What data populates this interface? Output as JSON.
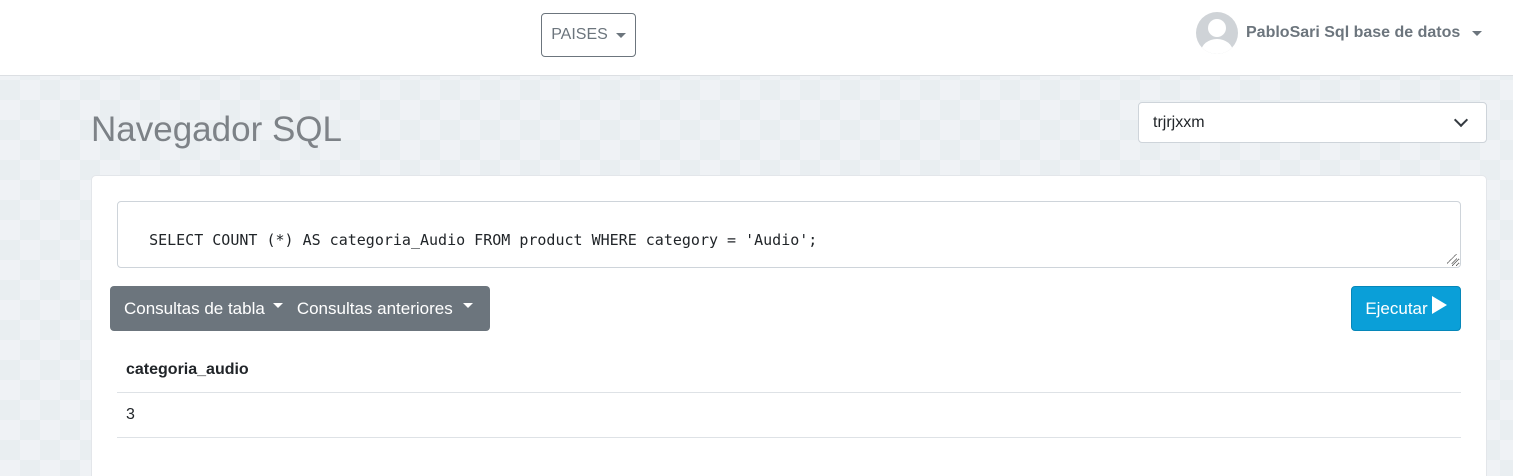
{
  "navbar": {
    "paises_label": "PAISES",
    "user_label": "PabloSari Sql base de datos"
  },
  "page": {
    "title": "Navegador SQL"
  },
  "database_select": {
    "selected": "trjrjxxm"
  },
  "query": {
    "text": "SELECT COUNT (*) AS categoria_Audio FROM product WHERE category = 'Audio';"
  },
  "toolbar": {
    "table_queries_label": "Consultas de tabla",
    "previous_queries_label": "Consultas anteriores",
    "run_label": "Ejecutar"
  },
  "results": {
    "columns": [
      "categoria_audio"
    ],
    "rows": [
      [
        "3"
      ]
    ]
  },
  "colors": {
    "run_button": "#0a9fd8",
    "button_group": "#6c757d"
  }
}
